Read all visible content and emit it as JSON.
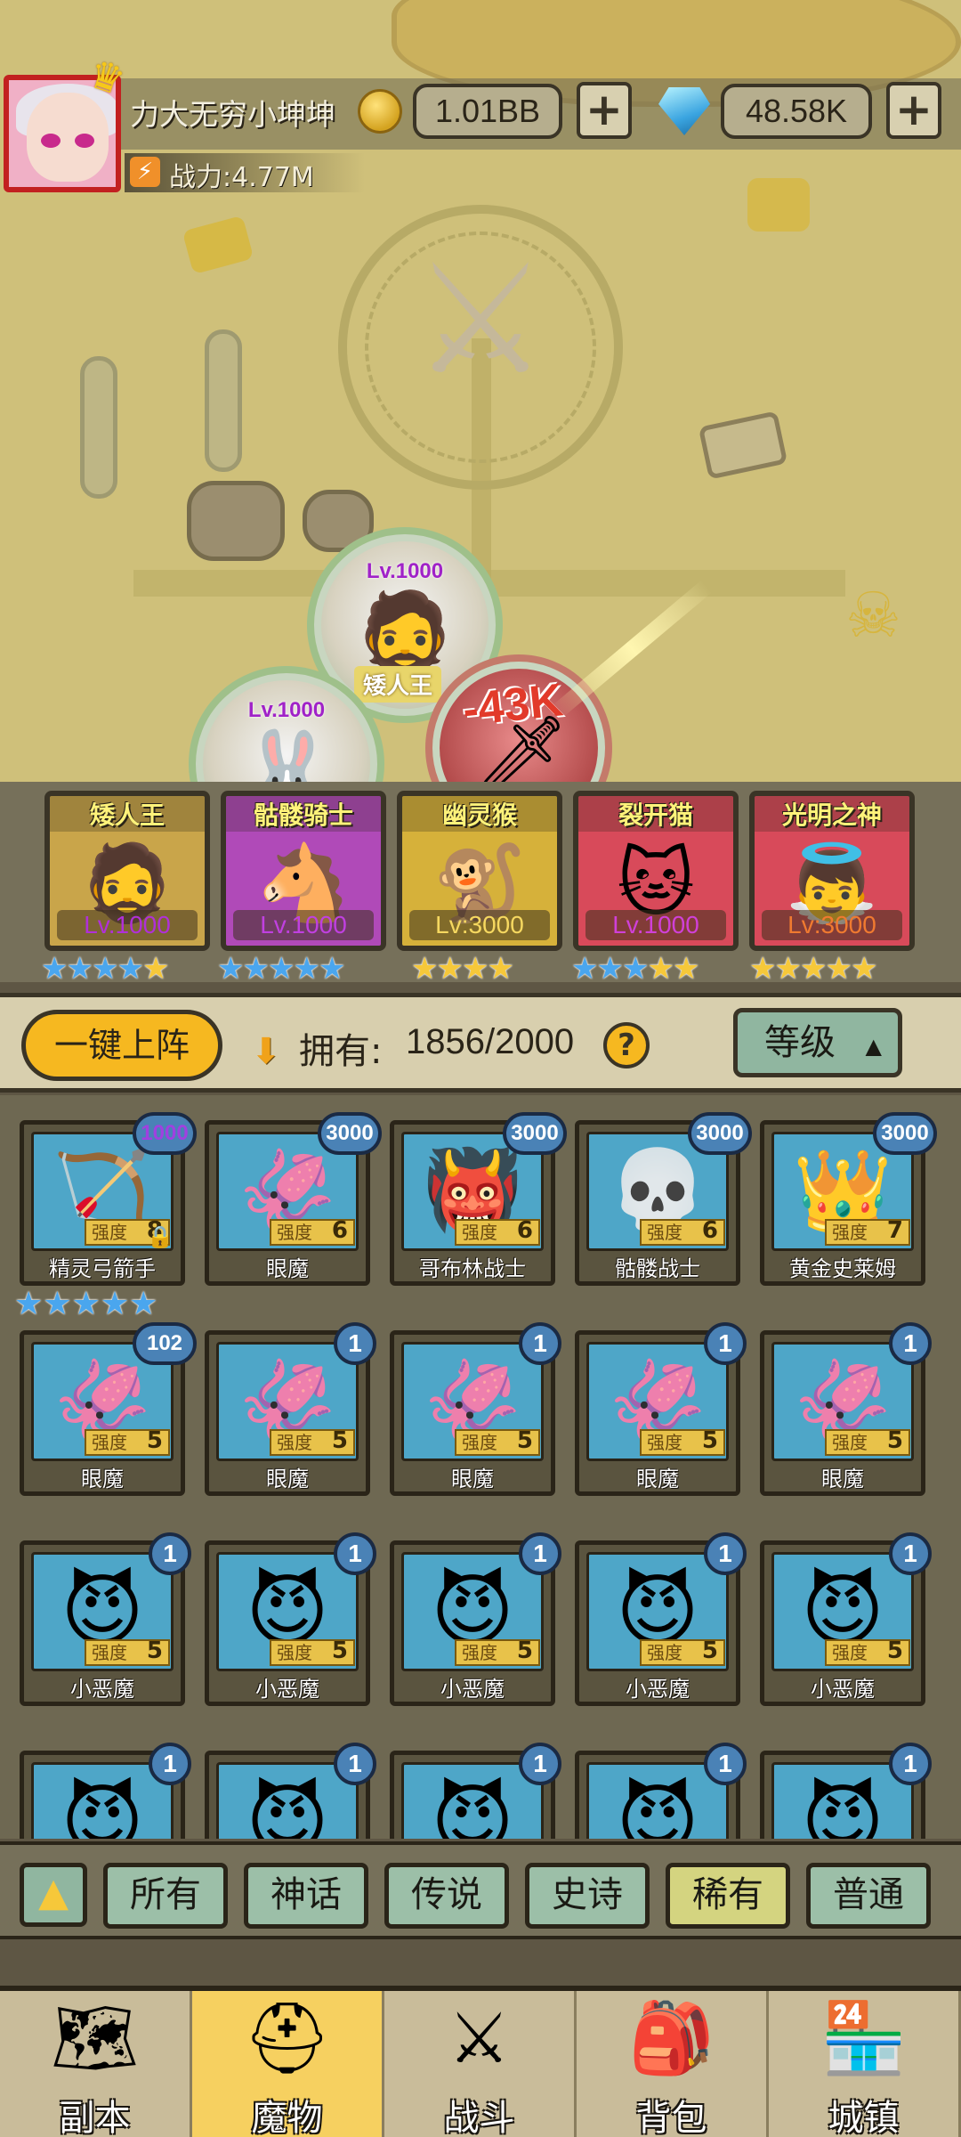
{
  "player": {
    "name": "力大无穷小坤坤",
    "gold": "1.01BB",
    "gems": "48.58K",
    "power": "战力:4.77M"
  },
  "battle": {
    "damage_text": "-43K",
    "bubbles": [
      {
        "level": "Lv.1000",
        "name": "矮人王"
      },
      {
        "level": "Lv.1000"
      }
    ]
  },
  "lineup": [
    {
      "name": "矮人王",
      "level": "Lv.1000",
      "bg": "#c9a54a",
      "lv_color": "#b030d8",
      "blue_stars": 4,
      "gold_stars": 1
    },
    {
      "name": "骷髅骑士",
      "level": "Lv.1000",
      "bg": "#b04ab8",
      "lv_color": "#c040e0",
      "blue_stars": 5,
      "gold_stars": 0
    },
    {
      "name": "幽灵猴",
      "level": "Lv:3000",
      "bg": "#d6b13a",
      "lv_color": "#f6d860",
      "blue_stars": 0,
      "gold_stars": 4
    },
    {
      "name": "裂开猫",
      "level": "Lv.1000",
      "bg": "#d84a5a",
      "lv_color": "#d040d8",
      "blue_stars": 3,
      "gold_stars": 2
    },
    {
      "name": "光明之神",
      "level": "Lv:3000",
      "bg": "#d84a5a",
      "lv_color": "#f07a30",
      "blue_stars": 0,
      "gold_stars": 5
    }
  ],
  "controls": {
    "deploy_label": "一键上阵",
    "own_label": "拥有:",
    "own_count": "1856/2000",
    "sort_label": "等级"
  },
  "monsters": {
    "power_label": "强度",
    "rows": [
      [
        {
          "name": "精灵弓箭手",
          "power": "8",
          "badge": "1000",
          "badge_color": "#a040e0",
          "locked": true
        },
        {
          "name": "眼魔",
          "power": "6",
          "badge": "3000"
        },
        {
          "name": "哥布林战士",
          "power": "6",
          "badge": "3000"
        },
        {
          "name": "骷髅战士",
          "power": "6",
          "badge": "3000"
        },
        {
          "name": "黄金史莱姆",
          "power": "7",
          "badge": "3000"
        }
      ],
      [
        {
          "name": "眼魔",
          "power": "5",
          "badge": "102"
        },
        {
          "name": "眼魔",
          "power": "5",
          "badge": "1"
        },
        {
          "name": "眼魔",
          "power": "5",
          "badge": "1"
        },
        {
          "name": "眼魔",
          "power": "5",
          "badge": "1"
        },
        {
          "name": "眼魔",
          "power": "5",
          "badge": "1"
        }
      ],
      [
        {
          "name": "小恶魔",
          "power": "5",
          "badge": "1"
        },
        {
          "name": "小恶魔",
          "power": "5",
          "badge": "1"
        },
        {
          "name": "小恶魔",
          "power": "5",
          "badge": "1"
        },
        {
          "name": "小恶魔",
          "power": "5",
          "badge": "1"
        },
        {
          "name": "小恶魔",
          "power": "5",
          "badge": "1"
        }
      ],
      [
        {
          "badge": "1"
        },
        {
          "badge": "1"
        },
        {
          "badge": "1"
        },
        {
          "badge": "1"
        },
        {
          "badge": "1"
        }
      ]
    ],
    "first_card_stars": 5
  },
  "filters": [
    "所有",
    "神话",
    "传说",
    "史诗",
    "稀有",
    "普通"
  ],
  "filter_active": "稀有",
  "nav": [
    {
      "label": "副本",
      "icon": "map-icon"
    },
    {
      "label": "魔物",
      "icon": "helmet-icon",
      "active": true
    },
    {
      "label": "战斗",
      "icon": "crossed-swords-icon"
    },
    {
      "label": "背包",
      "icon": "backpack-icon"
    },
    {
      "label": "城镇",
      "icon": "shop-icon"
    }
  ]
}
